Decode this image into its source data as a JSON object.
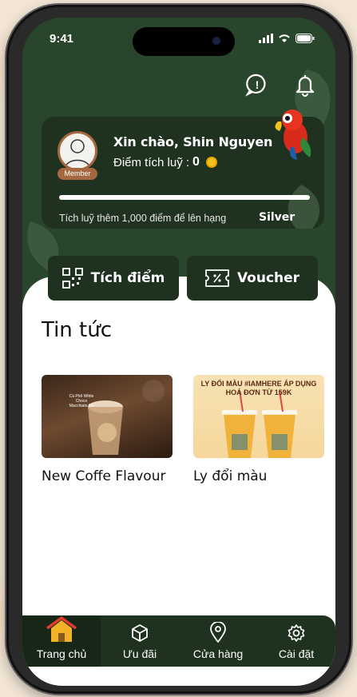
{
  "status": {
    "time": "9:41"
  },
  "header": {
    "support_icon": "chat-help-icon",
    "bell_icon": "bell-icon"
  },
  "member": {
    "greeting": "Xin chào, Shin Nguyen",
    "points_label": "Điểm tích luỹ :",
    "points_value": "0",
    "badge": "Member",
    "progress": 0,
    "hint": "Tích luỹ thêm 1,000 điểm để lên hạng",
    "next_tier": "Silver"
  },
  "actions": {
    "earn_label": "Tích điểm",
    "voucher_label": "Voucher"
  },
  "news": {
    "title": "Tin tức",
    "items": [
      {
        "caption": "New Coffe Flavour",
        "thumb_text": "Cà Phê White Choco Macchiato Đá"
      },
      {
        "caption": "Ly đổi màu",
        "thumb_text": "LY ĐỔI MÀU #IAMHERE ÁP DỤNG HOÁ ĐƠN TỪ 159K"
      }
    ]
  },
  "tabs": [
    {
      "label": "Trang chủ",
      "icon": "home-icon",
      "active": true
    },
    {
      "label": "Ưu đãi",
      "icon": "box-icon",
      "active": false
    },
    {
      "label": "Cửa hàng",
      "icon": "location-pin-icon",
      "active": false
    },
    {
      "label": "Cài đặt",
      "icon": "gear-icon",
      "active": false
    }
  ],
  "colors": {
    "primary": "#29452b",
    "card": "#1f3220",
    "accent": "#a56840",
    "coin": "#f4c21c"
  }
}
